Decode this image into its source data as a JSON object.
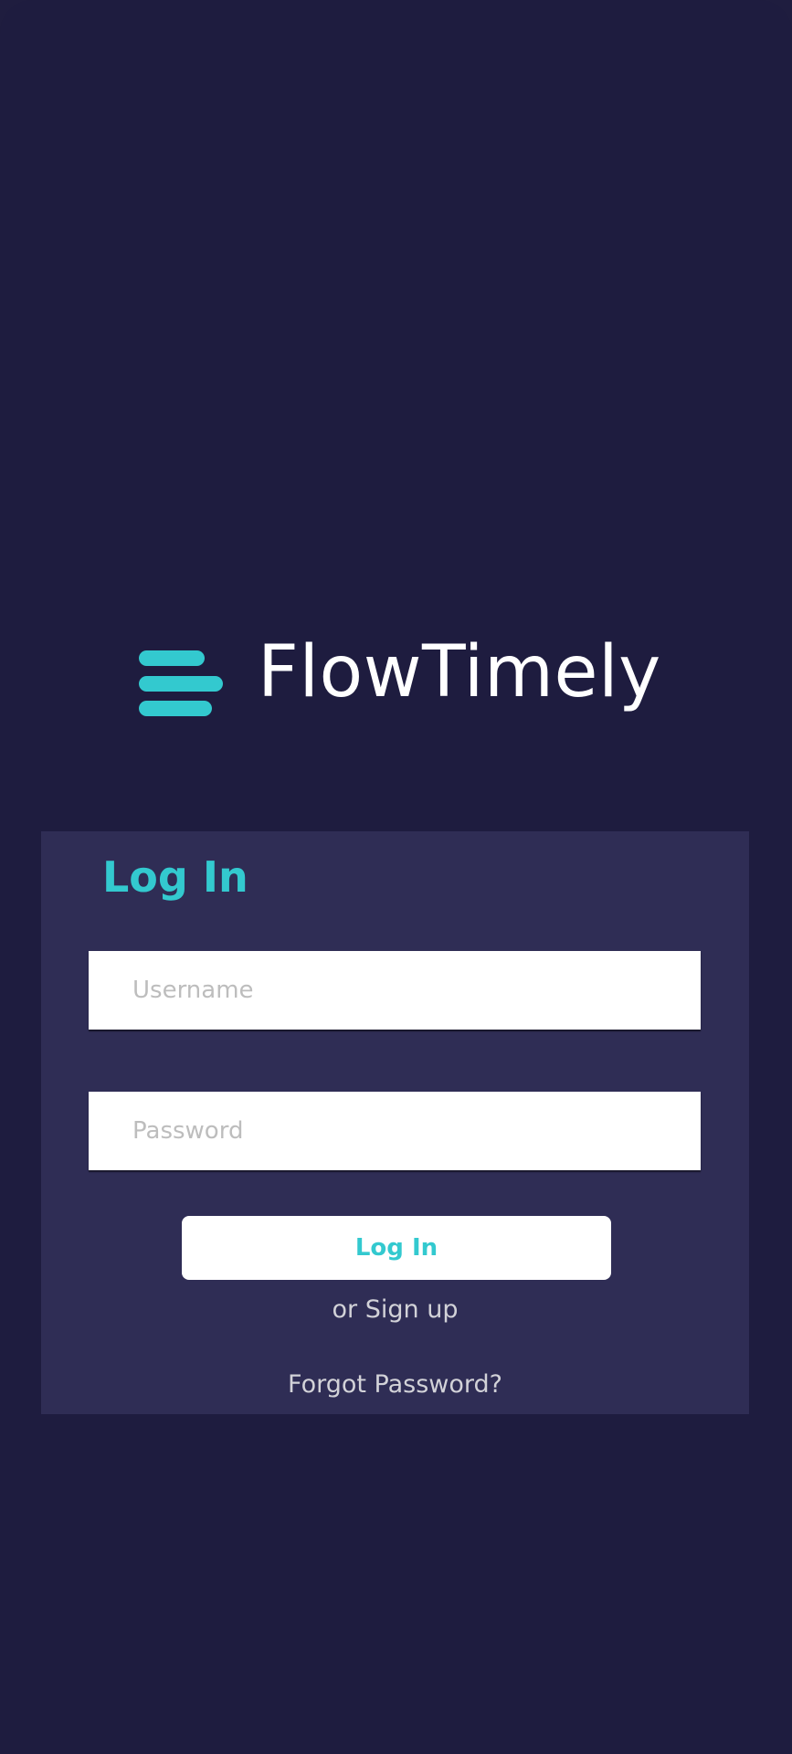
{
  "colors": {
    "background": "#1e1c3f",
    "card": "#2f2d55",
    "accent": "#33c9cf",
    "text_light": "#d2d2d8"
  },
  "brand": {
    "icon": "brand-stack-icon",
    "name": "FlowTimely"
  },
  "login": {
    "title": "Log In",
    "username_placeholder": "Username",
    "password_placeholder": "Password",
    "button_label": "Log In",
    "signup_text": "or Sign up",
    "forgot_text": "Forgot Password?"
  }
}
